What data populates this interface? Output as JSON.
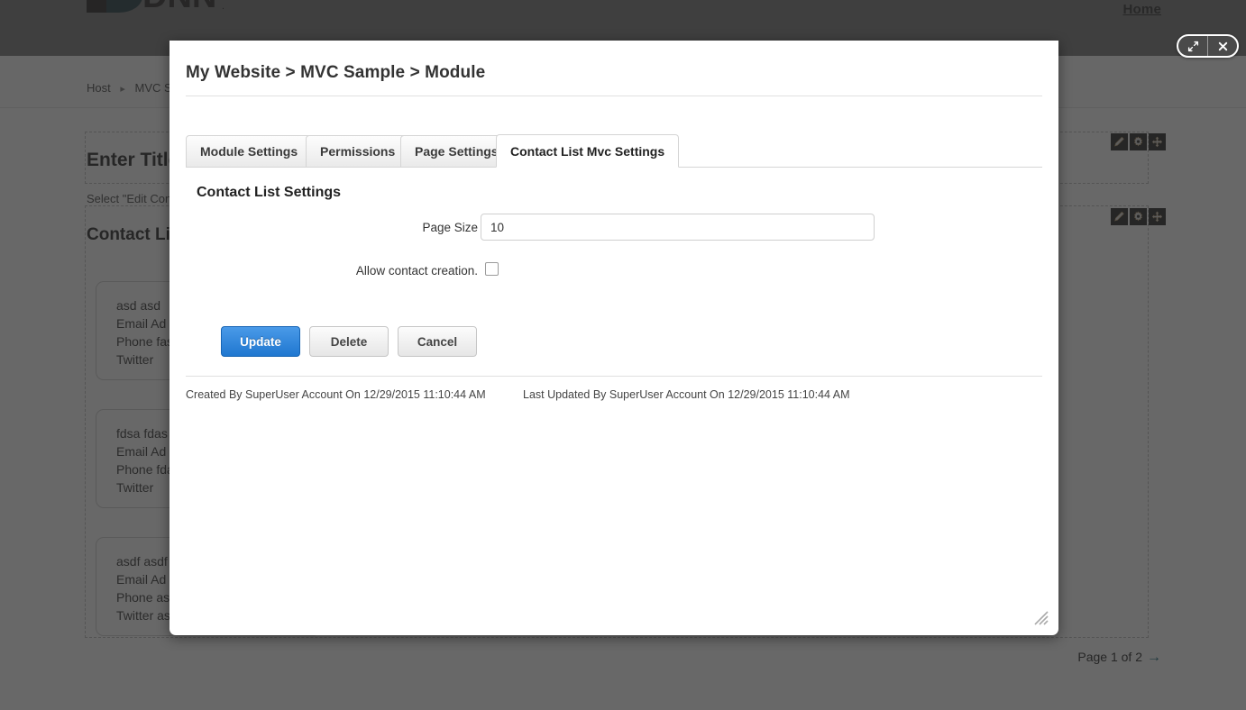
{
  "background": {
    "logo_alt": "DNN",
    "home_link": "Home",
    "breadcrumb": {
      "items": [
        "Host",
        "MVC S"
      ],
      "separator": "▸"
    },
    "pane_title_text": "Enter Title",
    "edit_hint": "Select \"Edit Cont",
    "contact_list_heading": "Contact Lis",
    "contacts": [
      {
        "name": "asd asd",
        "email": "Email Ad",
        "phone": "Phone fas",
        "twitter": "Twitter"
      },
      {
        "name": "fdsa fdas",
        "email": "Email Ad",
        "phone": "Phone fda",
        "twitter": "Twitter"
      },
      {
        "name": "asdf asdf",
        "email": "Email Ad",
        "phone": "Phone as",
        "twitter": "Twitter as"
      }
    ],
    "pager": {
      "text": "Page 1 of 2",
      "arrow": "→",
      "arrow_color": "#0e5f72"
    },
    "module_action_icons": [
      "pencil-icon",
      "gear-icon",
      "move-icon"
    ]
  },
  "modal": {
    "title": "My Website > MVC Sample > Module",
    "titlebar_buttons": [
      {
        "name": "maximize-icon",
        "label": "Maximize"
      },
      {
        "name": "close-icon",
        "label": "Close"
      }
    ],
    "tabs": [
      {
        "label": "Module Settings",
        "active": false
      },
      {
        "label": "Permissions",
        "active": false
      },
      {
        "label": "Page Settings",
        "active": false
      },
      {
        "label": "Contact List Mvc Settings",
        "active": true
      }
    ],
    "section_heading": "Contact List Settings",
    "fields": {
      "page_size": {
        "label": "Page Size",
        "value": "10",
        "placeholder": ""
      },
      "allow_contact_creation": {
        "label": "Allow contact creation.",
        "checked": false
      }
    },
    "buttons": {
      "update": "Update",
      "delete": "Delete",
      "cancel": "Cancel"
    },
    "audit": {
      "created": "Created By SuperUser Account On 12/29/2015 11:10:44 AM",
      "updated": "Last Updated By SuperUser Account On 12/29/2015 11:10:44 AM"
    }
  },
  "colors": {
    "primary_button": "#1f77d0",
    "overlay": "#4e4e4e",
    "pager_arrow": "#0e5f72"
  }
}
